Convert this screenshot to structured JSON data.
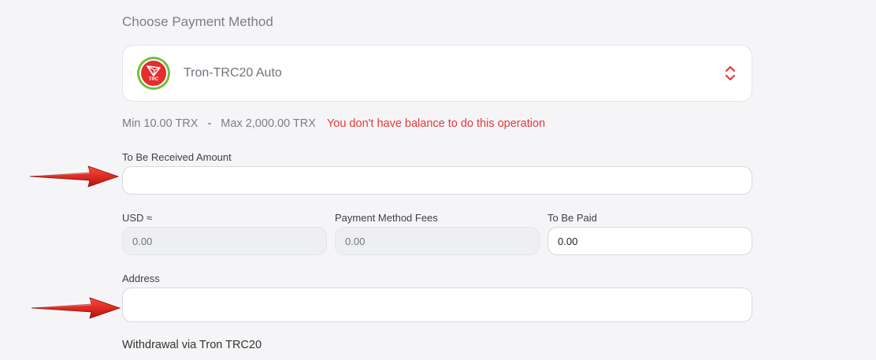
{
  "section_title": "Choose Payment Method",
  "payment_method": {
    "name": "Tron-TRC20 Auto",
    "logo_text": "TRC"
  },
  "limits": {
    "min": "Min 10.00 TRX",
    "separator": "-",
    "max": "Max 2,000.00 TRX",
    "error": "You don't have balance to do this operation"
  },
  "received_amount": {
    "label": "To Be Received Amount",
    "value": ""
  },
  "usd": {
    "label": "USD ≈",
    "placeholder": "0.00"
  },
  "fees": {
    "label": "Payment Method Fees",
    "placeholder": "0.00"
  },
  "to_be_paid": {
    "label": "To Be Paid",
    "value": "0.00"
  },
  "address": {
    "label": "Address",
    "value": ""
  },
  "withdrawal_note": "Withdrawal via Tron TRC20",
  "colors": {
    "error": "#e53935",
    "arrow": "#e0201a",
    "logo_red": "#e42d2d",
    "logo_green": "#6fbf3a"
  },
  "icons": [
    "tron-logo-icon",
    "chevron-updown-icon",
    "red-arrow-icon"
  ]
}
